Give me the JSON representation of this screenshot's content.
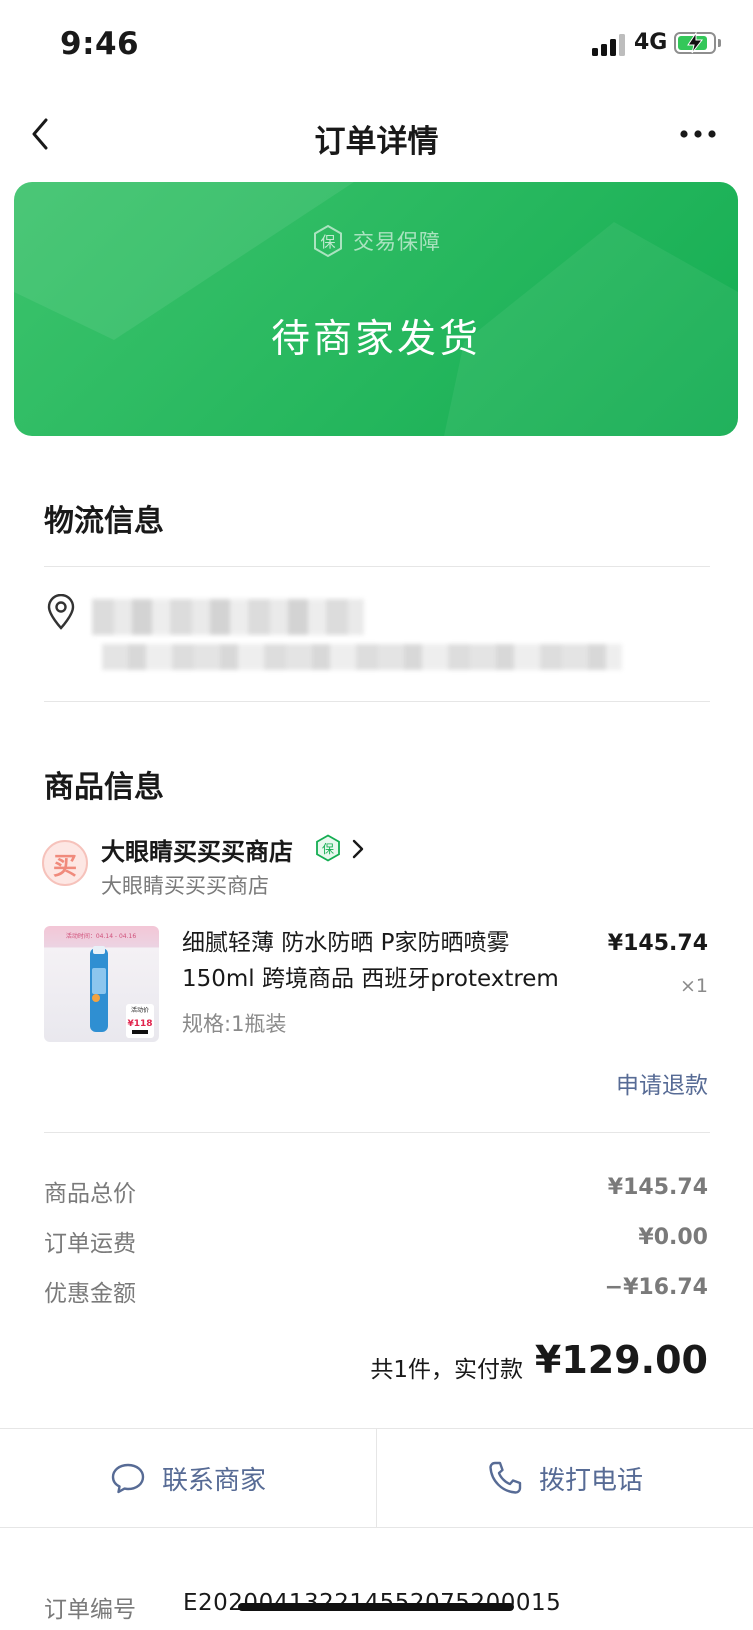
{
  "status_bar": {
    "time": "9:46",
    "network": "4G"
  },
  "nav": {
    "title": "订单详情"
  },
  "banner": {
    "guarantee": "交易保障",
    "status": "待商家发货"
  },
  "logistics": {
    "title": "物流信息"
  },
  "goods": {
    "title": "商品信息",
    "shop": {
      "logo_char": "买",
      "name": "大眼睛买买买商店",
      "sub_name": "大眼睛买买买商店",
      "badge": "保"
    },
    "product": {
      "name": "细腻轻薄 防水防晒 P家防晒喷雾150ml 跨境商品 西班牙protextrem",
      "spec": "规格:1瓶装",
      "price": "¥145.74",
      "qty": "×1",
      "image_labels": {
        "top": "活动时间：04.14 - 04.16",
        "badge": "活动价",
        "price": "¥118"
      }
    },
    "refund": "申请退款"
  },
  "summary": {
    "items": [
      {
        "label": "商品总价",
        "value": "¥145.74"
      },
      {
        "label": "订单运费",
        "value": "¥0.00"
      },
      {
        "label": "优惠金额",
        "value": "−¥16.74"
      }
    ],
    "paid_label": "共1件，实付款",
    "paid_amount": "¥129.00"
  },
  "actions": {
    "contact": "联系商家",
    "call": "拨打电话"
  },
  "order": {
    "label": "订单编号",
    "number": "E20200413221455207520001​5"
  },
  "colors": {
    "brand_green": "#14ad52",
    "link_blue": "#576b95"
  }
}
